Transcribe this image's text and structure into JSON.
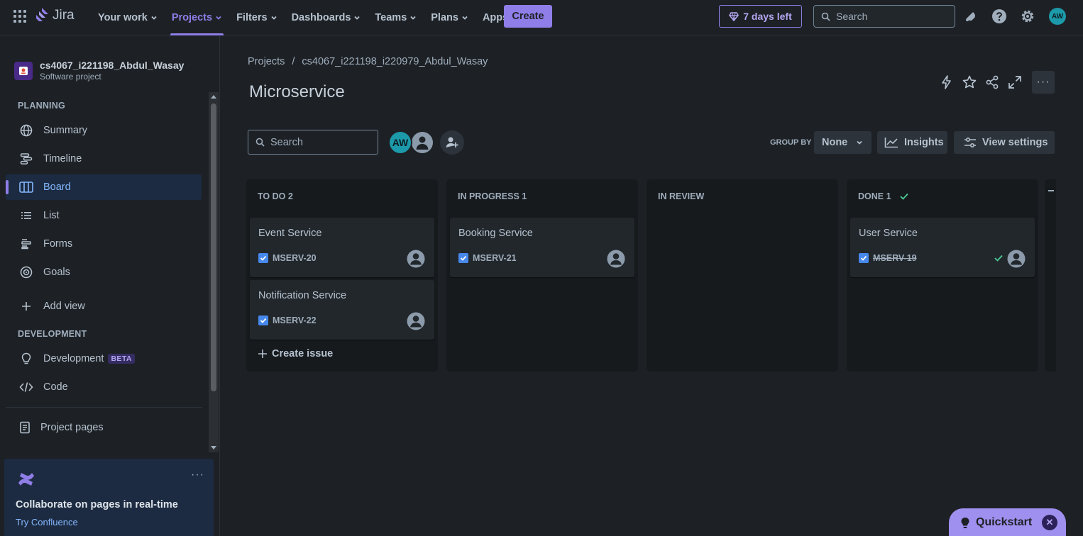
{
  "topnav": {
    "logo_text": "Jira",
    "items": [
      {
        "label": "Your work"
      },
      {
        "label": "Projects"
      },
      {
        "label": "Filters"
      },
      {
        "label": "Dashboards"
      },
      {
        "label": "Teams"
      },
      {
        "label": "Plans"
      },
      {
        "label": "Apps"
      }
    ],
    "active_item": "Projects",
    "create_label": "Create",
    "trial_label": "7 days left",
    "search_placeholder": "Search",
    "user_initials": "AW"
  },
  "sidebar": {
    "project_name": "cs4067_i221198_Abdul_Wasay",
    "project_type": "Software project",
    "planning_header": "PLANNING",
    "planning_items": [
      {
        "label": "Summary",
        "icon": "globe-icon"
      },
      {
        "label": "Timeline",
        "icon": "timeline-icon"
      },
      {
        "label": "Board",
        "icon": "board-icon",
        "active": true
      },
      {
        "label": "List",
        "icon": "list-icon"
      },
      {
        "label": "Forms",
        "icon": "forms-icon"
      },
      {
        "label": "Goals",
        "icon": "goals-icon"
      }
    ],
    "add_view_label": "Add view",
    "development_header": "DEVELOPMENT",
    "development_items": [
      {
        "label": "Development",
        "icon": "lightbulb-icon",
        "badge": "BETA"
      },
      {
        "label": "Code",
        "icon": "code-icon"
      }
    ],
    "project_pages_label": "Project pages",
    "promo": {
      "title": "Collaborate on pages in real-time",
      "link": "Try Confluence"
    }
  },
  "board": {
    "breadcrumb": [
      "Projects",
      "/",
      "cs4067_i221198_i220979_Abdul_Wasay"
    ],
    "title": "Microservice",
    "search_placeholder": "Search",
    "avatar_initials": "AW",
    "group_by_label": "GROUP BY",
    "group_by_value": "None",
    "insights_label": "Insights",
    "view_settings_label": "View settings",
    "columns": [
      {
        "title": "TO DO 2",
        "cards": [
          {
            "title": "Event Service",
            "key": "MSERV-20"
          },
          {
            "title": "Notification Service",
            "key": "MSERV-22"
          }
        ],
        "create_label": "Create issue"
      },
      {
        "title": "IN PROGRESS 1",
        "cards": [
          {
            "title": "Booking Service",
            "key": "MSERV-21"
          }
        ]
      },
      {
        "title": "IN REVIEW",
        "cards": []
      },
      {
        "title": "DONE 1",
        "cards": [
          {
            "title": "User Service",
            "key": "MSERV-19",
            "done": true
          }
        ]
      }
    ]
  },
  "quickstart_label": "Quickstart",
  "colors": {
    "accent": "#8f7ee7",
    "background": "#1d2125",
    "column": "#161a1d",
    "card": "#22272b",
    "link": "#85b8ff",
    "done_check": "#4bce97"
  }
}
